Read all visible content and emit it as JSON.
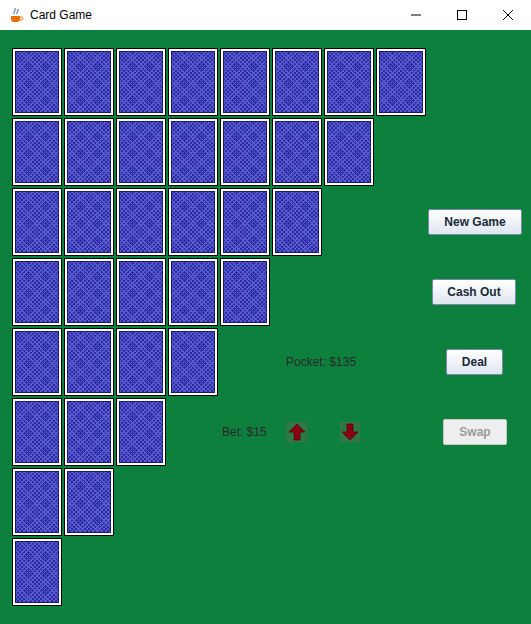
{
  "window": {
    "title": "Card Game"
  },
  "card_rows": [
    [
      {
        "face_down": true
      },
      {
        "face_down": true
      },
      {
        "face_down": true
      },
      {
        "face_down": true
      },
      {
        "face_down": true
      },
      {
        "face_down": true
      },
      {
        "face_down": true
      },
      {
        "face_down": true
      }
    ],
    [
      {
        "face_down": true
      },
      {
        "face_down": true
      },
      {
        "face_down": true
      },
      {
        "face_down": true
      },
      {
        "face_down": true
      },
      {
        "face_down": true
      },
      {
        "face_down": true
      }
    ],
    [
      {
        "face_down": true
      },
      {
        "face_down": true
      },
      {
        "face_down": true
      },
      {
        "face_down": true
      },
      {
        "face_down": true
      },
      {
        "face_down": true
      }
    ],
    [
      {
        "face_down": true
      },
      {
        "face_down": true
      },
      {
        "face_down": true
      },
      {
        "face_down": true
      },
      {
        "face_down": true
      }
    ],
    [
      {
        "face_down": true
      },
      {
        "face_down": true
      },
      {
        "face_down": true
      },
      {
        "face_down": true
      }
    ],
    [
      {
        "face_down": true
      },
      {
        "face_down": true
      },
      {
        "face_down": true
      }
    ],
    [
      {
        "face_down": true
      },
      {
        "face_down": true
      }
    ],
    [
      {
        "face_down": true
      }
    ]
  ],
  "buttons": {
    "new_game": {
      "label": "New Game",
      "disabled": false
    },
    "cash_out": {
      "label": "Cash Out",
      "disabled": false
    },
    "deal": {
      "label": "Deal",
      "disabled": false
    },
    "swap": {
      "label": "Swap",
      "disabled": true
    }
  },
  "pocket": "Pocket: $135",
  "bet": "Bet: $15"
}
